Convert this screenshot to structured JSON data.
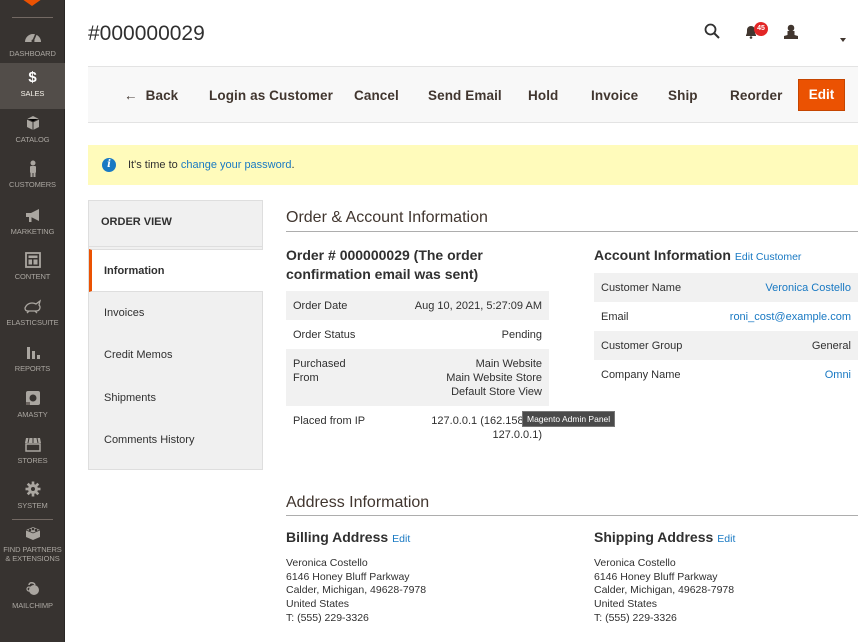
{
  "sidebar": {
    "items": [
      {
        "label": "Dashboard",
        "icon": "dashboard-icon"
      },
      {
        "label": "Sales",
        "icon": "dollar-icon",
        "active": true
      },
      {
        "label": "Catalog",
        "icon": "box-icon"
      },
      {
        "label": "Customers",
        "icon": "person-icon"
      },
      {
        "label": "Marketing",
        "icon": "megaphone-icon"
      },
      {
        "label": "Content",
        "icon": "layout-icon"
      },
      {
        "label": "ElasticSuite",
        "icon": "rabbit-icon"
      },
      {
        "label": "Reports",
        "icon": "bar-chart-icon"
      },
      {
        "label": "Amasty",
        "icon": "amasty-icon"
      },
      {
        "label": "Stores",
        "icon": "storefront-icon"
      },
      {
        "label": "System",
        "icon": "gear-icon"
      },
      {
        "label": "Find Partners & Extensions",
        "line1": "Find Partners",
        "line2": "& Extensions",
        "icon": "extensions-icon"
      },
      {
        "label": "Mailchimp",
        "icon": "mailchimp-icon"
      }
    ]
  },
  "header": {
    "title": "#000000029",
    "notifications_count": "45",
    "icons": [
      "search-icon",
      "bell-icon",
      "user-icon",
      "caret-down-icon"
    ]
  },
  "actions": {
    "back": "Back",
    "login_as_customer": "Login as Customer",
    "cancel": "Cancel",
    "send_email": "Send Email",
    "hold": "Hold",
    "invoice": "Invoice",
    "ship": "Ship",
    "reorder": "Reorder",
    "edit": "Edit"
  },
  "message": {
    "prefix": "It's time to ",
    "link": "change your password",
    "suffix": "."
  },
  "tabs": {
    "title": "ORDER VIEW",
    "items": [
      "Information",
      "Invoices",
      "Credit Memos",
      "Shipments",
      "Comments History"
    ],
    "active": "Information"
  },
  "order_account": {
    "section_title": "Order & Account Information",
    "order_heading_line1": "Order # 000000029 (The order",
    "order_heading_line2": "confirmation email was sent)",
    "order_rows": [
      {
        "label": "Order Date",
        "value": "Aug 10, 2021, 5:27:09 AM"
      },
      {
        "label": "Order Status",
        "value": "Pending"
      },
      {
        "label_line1": "Purchased",
        "label_line2": "From",
        "value_line1": "Main Website",
        "value_line2": "Main Website Store",
        "value_line3": "Default Store View"
      },
      {
        "label": "Placed from IP",
        "value_line1": "127.0.0.1 (162.158.91.",
        "value_line2": "127.0.0.1)"
      }
    ],
    "tooltip": "Magento Admin Panel",
    "account_heading": "Account Information",
    "account_edit": "Edit Customer",
    "account_rows": [
      {
        "label": "Customer Name",
        "value": "Veronica Costello",
        "link": true
      },
      {
        "label": "Email",
        "value": "roni_cost@example.com",
        "link": true
      },
      {
        "label": "Customer Group",
        "value": "General",
        "link": false
      },
      {
        "label": "Company Name",
        "value": "Omni",
        "link": true
      }
    ]
  },
  "address": {
    "section_title": "Address Information",
    "billing": {
      "heading": "Billing Address",
      "edit": "Edit",
      "lines": [
        "Veronica Costello",
        "6146 Honey Bluff Parkway",
        "Calder, Michigan, 49628-7978",
        "United States",
        "T: (555) 229-3326"
      ]
    },
    "shipping": {
      "heading": "Shipping Address",
      "edit": "Edit",
      "lines": [
        "Veronica Costello",
        "6146 Honey Bluff Parkway",
        "Calder, Michigan, 49628-7978",
        "United States",
        "T: (555) 229-3326"
      ]
    }
  },
  "colors": {
    "accent": "#eb5202",
    "link": "#1979c3",
    "sidebar_bg": "#373330",
    "message_bg": "#fffbbb",
    "badge": "#e22626"
  }
}
